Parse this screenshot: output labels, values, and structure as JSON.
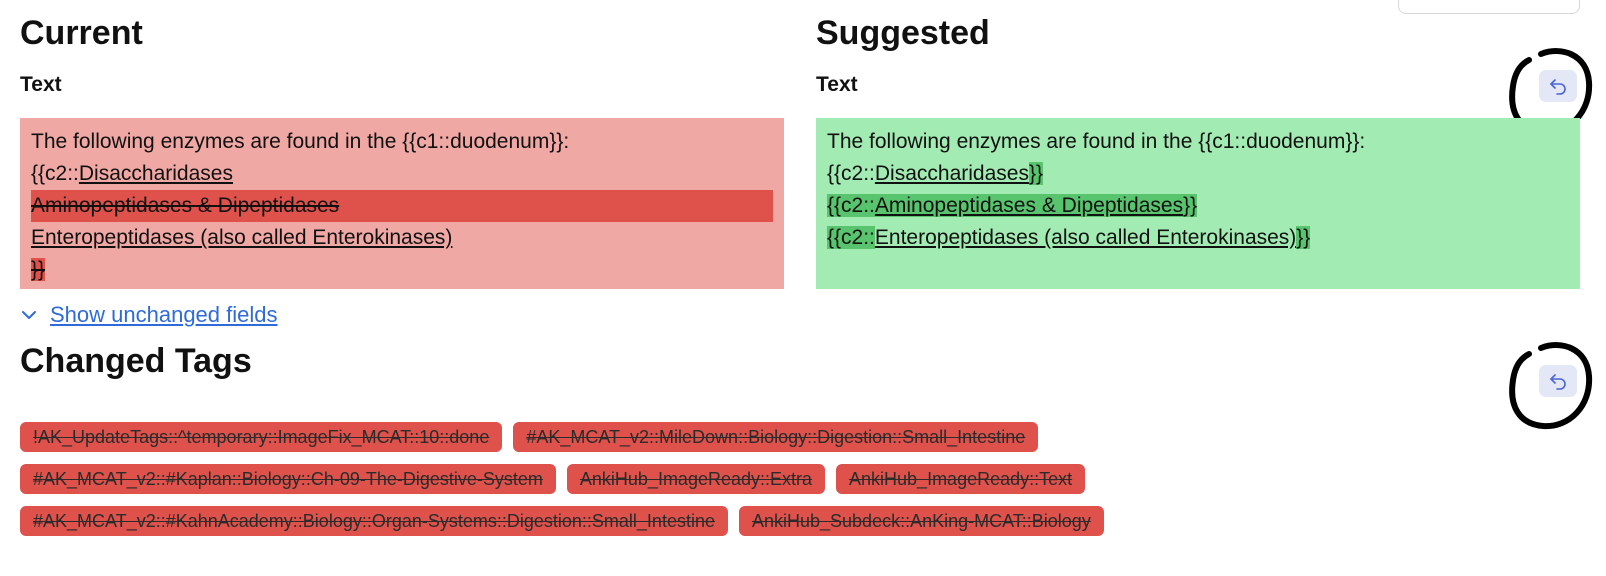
{
  "current": {
    "heading": "Current",
    "field_label": "Text",
    "line1": "The following enzymes are found in the {{c1::duodenum}}:",
    "line2_prefix": "{{c2::",
    "line2_link": "Disaccharidases",
    "line3_removed": "Aminopeptidases & Dipeptidases",
    "line4_link": "Enteropeptidases (also called Enterokinases)",
    "line5_removed": "}}"
  },
  "suggested": {
    "heading": "Suggested",
    "field_label": "Text",
    "line1": "The following enzymes are found in the {{c1::duodenum}}:",
    "line2_prefix": "{{c2::",
    "line2_link": "Disaccharidases",
    "line2_added": "}}",
    "line3_prefix": "{{c2::",
    "line3_link": "Aminopeptidases & Dipeptidases",
    "line3_suffix": "}}",
    "line4_prefix": "{{c2::",
    "line4_link": "Enteropeptidases (also called Enterokinases)",
    "line4_added": "}}"
  },
  "show_unchanged": {
    "label": "Show unchanged fields",
    "icon": "chevron-down-icon"
  },
  "changed_tags": {
    "heading": "Changed Tags",
    "tags": [
      "!AK_UpdateTags::^temporary::ImageFix_MCAT::10::done",
      "#AK_MCAT_v2::MileDown::Biology::Digestion::Small_Intestine",
      "#AK_MCAT_v2::#Kaplan::Biology::Ch-09-The-Digestive-System",
      "AnkiHub_ImageReady::Extra",
      "AnkiHub_ImageReady::Text",
      "#AK_MCAT_v2::#KahnAcademy::Biology::Organ-Systems::Digestion::Small_Intestine",
      "AnkiHub_Subdeck::AnKing-MCAT::Biology"
    ]
  },
  "icons": {
    "revert": "revert-undo-icon"
  },
  "colors": {
    "removed_bg": "#f0a8a5",
    "removed_highlight": "#de524b",
    "added_bg": "#a2ebb3",
    "added_highlight": "#58c46d",
    "link": "#2f6bd8",
    "revert_button_bg": "#e3e7f6"
  }
}
